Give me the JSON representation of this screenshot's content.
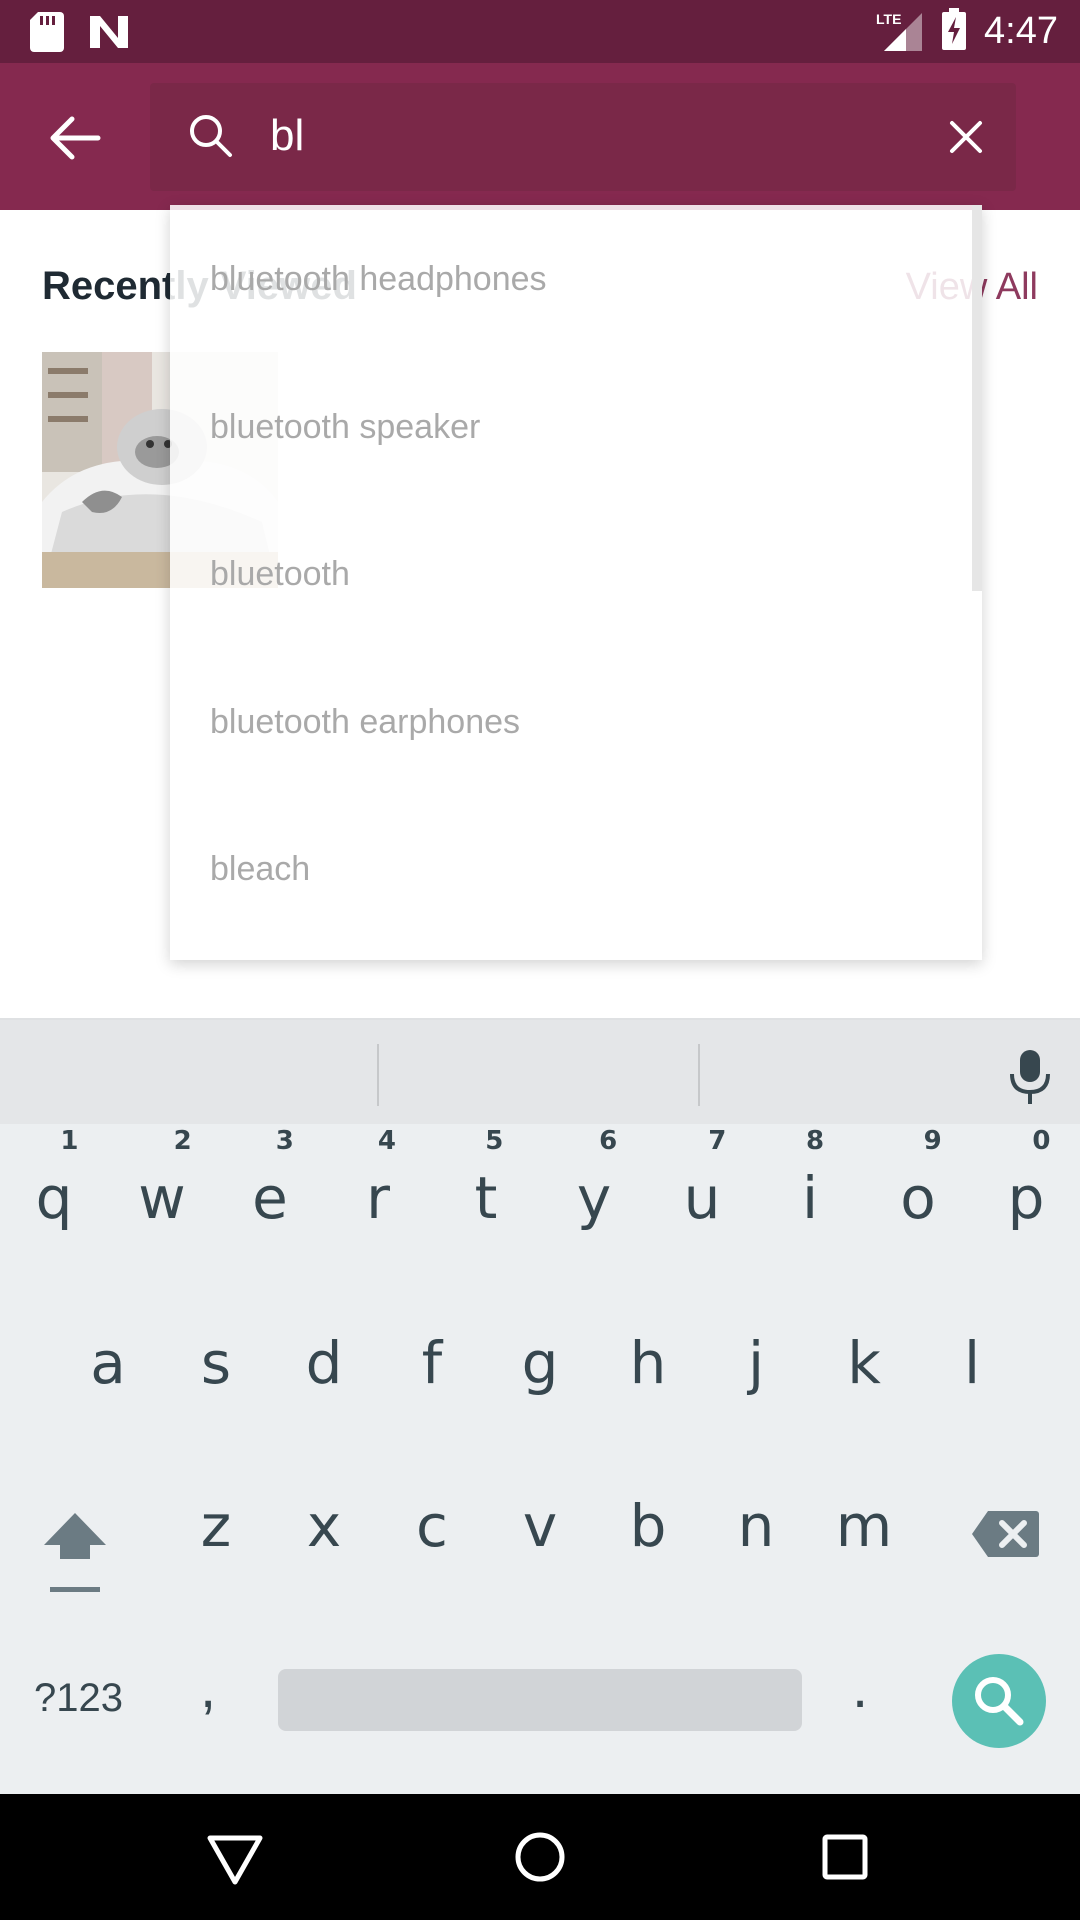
{
  "status_bar": {
    "time": "4:47",
    "network_label": "LTE",
    "icons": [
      "sd-card-icon",
      "notification-n-icon",
      "lte-signal-icon",
      "battery-charging-icon"
    ]
  },
  "search": {
    "query": "bl",
    "placeholder": ""
  },
  "recently_viewed": {
    "title": "Recently Viewed",
    "view_all_label": "View All"
  },
  "suggestions": [
    {
      "label": "bluetooth headphones"
    },
    {
      "label": "bluetooth speaker"
    },
    {
      "label": "bluetooth"
    },
    {
      "label": "bluetooth earphones"
    },
    {
      "label": "bleach"
    }
  ],
  "keyboard": {
    "row1": [
      {
        "k": "q",
        "n": "1"
      },
      {
        "k": "w",
        "n": "2"
      },
      {
        "k": "e",
        "n": "3"
      },
      {
        "k": "r",
        "n": "4"
      },
      {
        "k": "t",
        "n": "5"
      },
      {
        "k": "y",
        "n": "6"
      },
      {
        "k": "u",
        "n": "7"
      },
      {
        "k": "i",
        "n": "8"
      },
      {
        "k": "o",
        "n": "9"
      },
      {
        "k": "p",
        "n": "0"
      }
    ],
    "row2": [
      "a",
      "s",
      "d",
      "f",
      "g",
      "h",
      "j",
      "k",
      "l"
    ],
    "row3": [
      "z",
      "x",
      "c",
      "v",
      "b",
      "n",
      "m"
    ],
    "symbols_label": "?123",
    "comma_label": ",",
    "period_label": "."
  },
  "colors": {
    "status_bar": "#651f3e",
    "app_bar": "#85294f",
    "accent_link": "#8e3a5e",
    "search_key": "#5bc0b5"
  }
}
